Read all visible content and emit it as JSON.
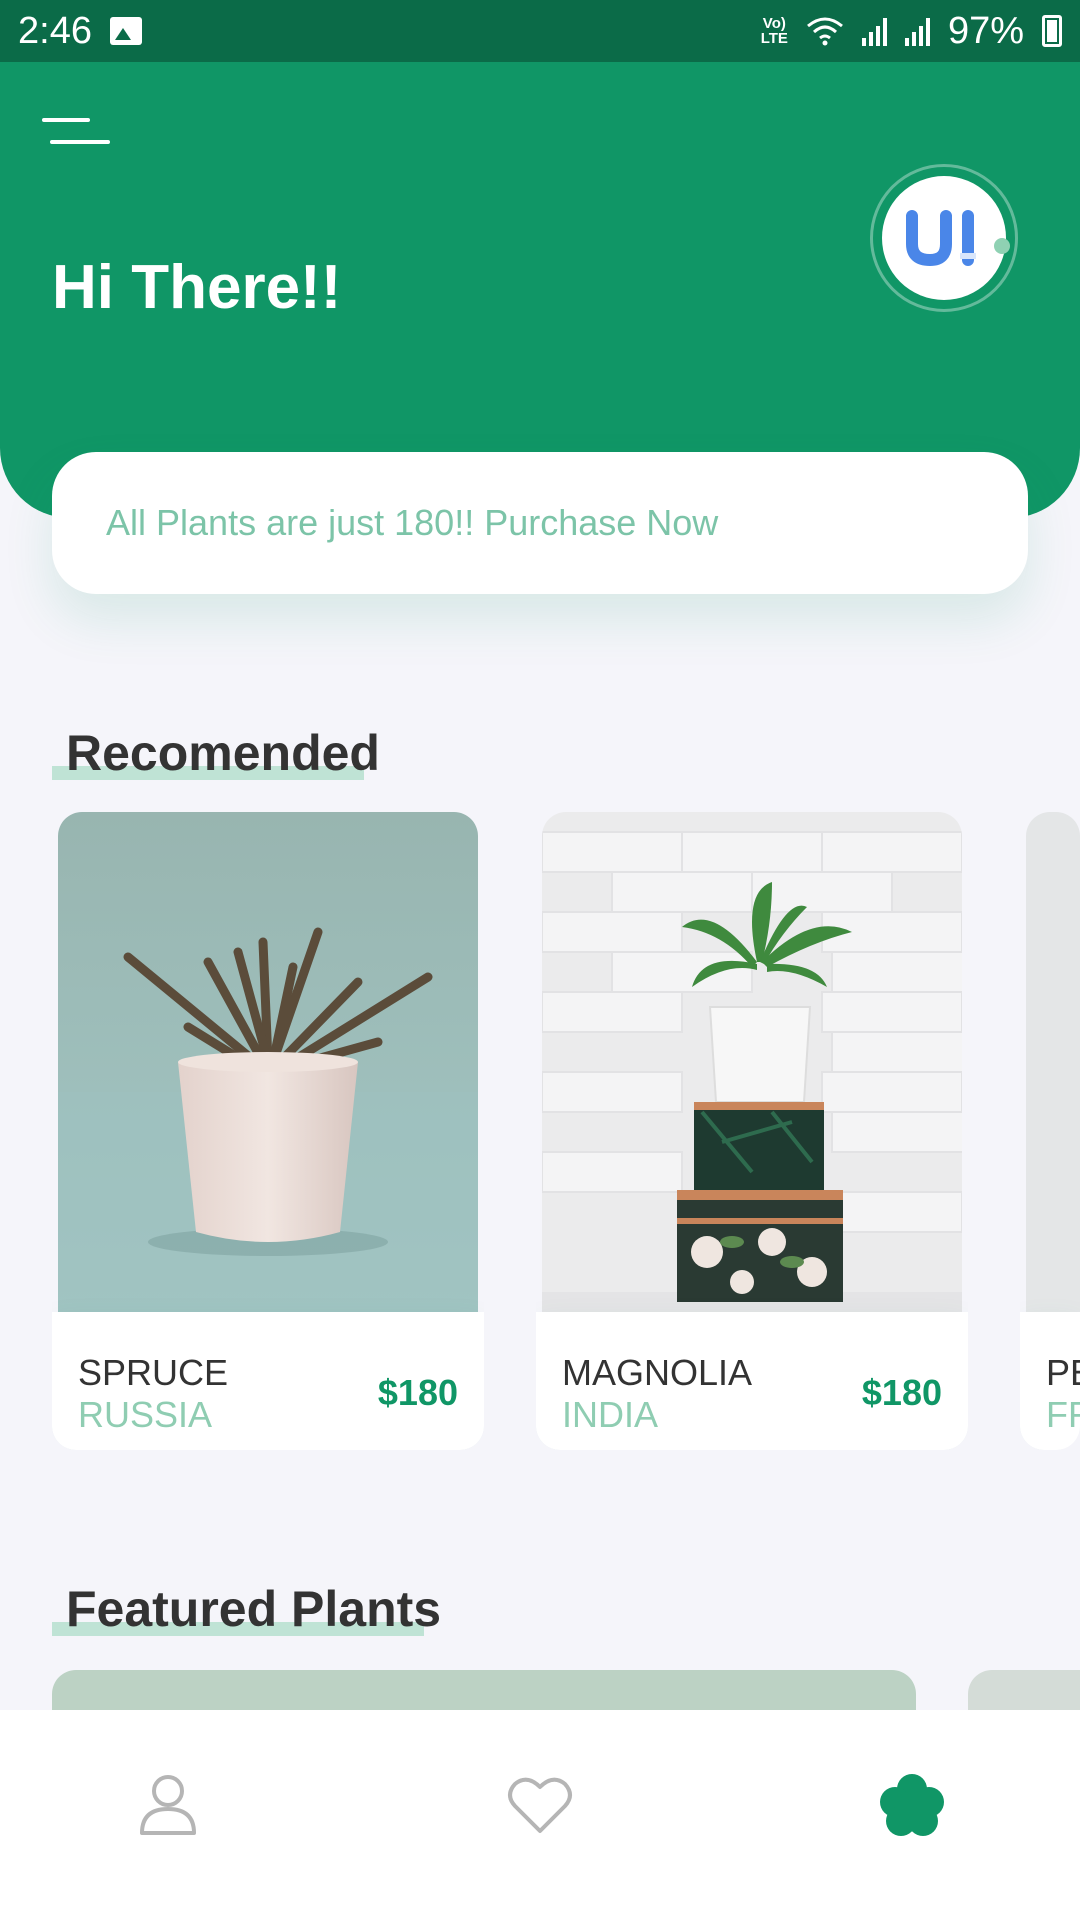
{
  "status_bar": {
    "time": "2:46",
    "network_label": "Vo) LTE",
    "battery_percent": "97%"
  },
  "header": {
    "greeting": "Hi There!!",
    "avatar_text": "UI"
  },
  "promo": {
    "placeholder": "All Plants are just 180!! Purchase Now"
  },
  "recommended": {
    "title": "Recomended",
    "items": [
      {
        "name": "SPRUCE",
        "country": "RUSSIA",
        "price": "$180"
      },
      {
        "name": "MAGNOLIA",
        "country": "INDIA",
        "price": "$180"
      },
      {
        "name": "PE",
        "country": "FF",
        "price": ""
      }
    ]
  },
  "featured": {
    "title": "Featured Plants"
  },
  "bottom_nav": {
    "items": [
      {
        "icon": "user-icon",
        "active": false
      },
      {
        "icon": "heart-icon",
        "active": false
      },
      {
        "icon": "flower-icon",
        "active": true
      }
    ]
  },
  "colors": {
    "primary": "#109666",
    "status_bar": "#0b6b48",
    "accent_light": "#bfe3d5",
    "muted_text": "#8fcdb2"
  }
}
